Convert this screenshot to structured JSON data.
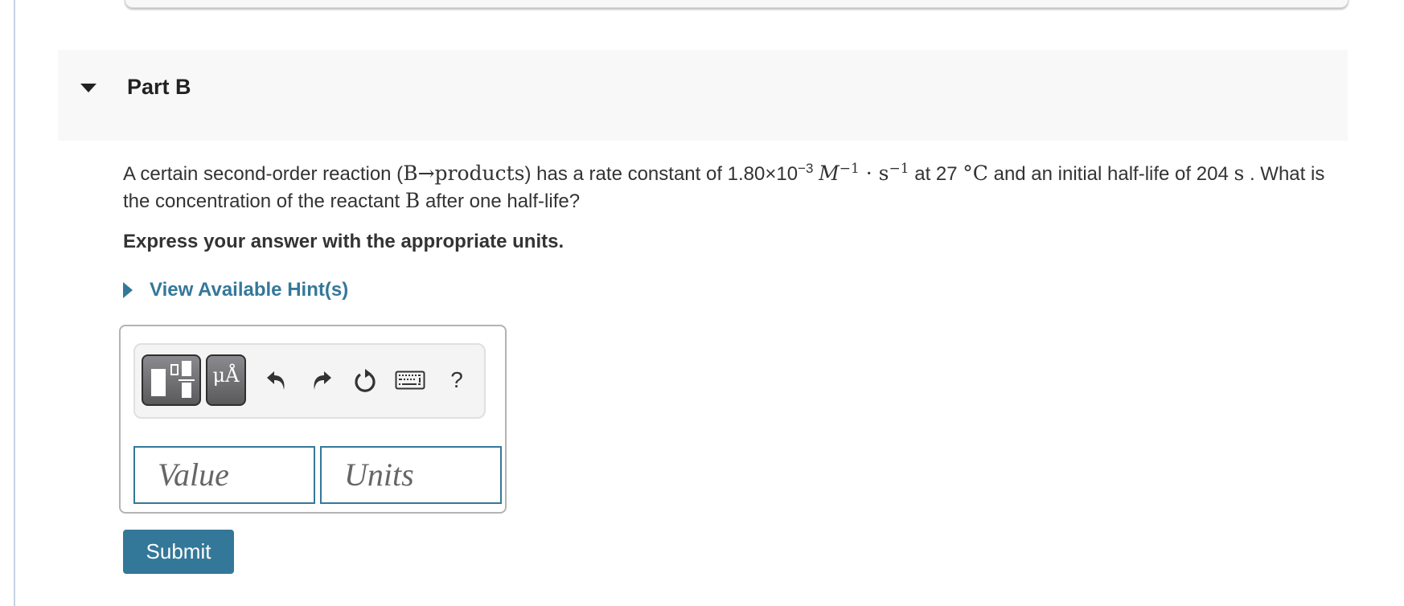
{
  "part": {
    "title": "Part B",
    "expanded": true
  },
  "question": {
    "t1": "A certain second-order reaction (",
    "reaction_reactant": "B",
    "reaction_arrow": "→",
    "reaction_products": "products",
    "t2": ") has a rate constant of 1.80×10",
    "exp_rate": "−3",
    "unit_M": "M",
    "exp_M": "−1",
    "dot": " · ",
    "unit_s": "s",
    "exp_s": "−1",
    "t3": "  at 27 ",
    "deg": "°",
    "unit_C": "C",
    "t4": " and an initial half-life of 204 ",
    "unit_s2": "s",
    "t5": " . What is the concentration of the reactant ",
    "reactant": "B",
    "t6": " after one half-life?"
  },
  "instruction": "Express your answer with the appropriate units.",
  "hint": {
    "label": "View Available Hint(s)"
  },
  "toolbar": {
    "units_button_label": "μÅ",
    "help_label": "?"
  },
  "inputs": {
    "value_placeholder": "Value",
    "value": "",
    "units_placeholder": "Units",
    "units": ""
  },
  "submit_label": "Submit",
  "colors": {
    "accent": "#347899",
    "header_bg": "#f8f8f8",
    "text": "#333333"
  }
}
